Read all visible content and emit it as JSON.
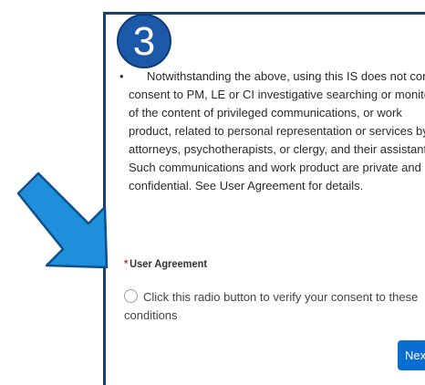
{
  "step_badge": "3",
  "notice": {
    "lines": [
      "Notwithstanding the above, using this IS does not constitute",
      "consent to PM, LE or CI investigative searching or monitoring",
      "of the content of privileged communications, or work",
      "product, related to personal representation or services by",
      "attorneys, psychotherapists, or clergy, and their assistants.",
      "Such communications and work product are private and",
      "confidential. See User Agreement for details."
    ]
  },
  "user_agreement": {
    "required_marker": "*",
    "label": "User Agreement",
    "radio_label_line1": "Click this radio button to verify your consent to these",
    "radio_label_line2": "conditions",
    "selected": false
  },
  "actions": {
    "next_label": "Next"
  },
  "colors": {
    "accent": "#0a6ed1",
    "badge": "#1c59a8",
    "arrow": "#1f8fdc",
    "panel_border": "#1c3f6e",
    "required": "#c23934"
  },
  "icons": {
    "pointer": "arrow-pointing-down-right-icon",
    "radio": "radio-unchecked-icon"
  }
}
